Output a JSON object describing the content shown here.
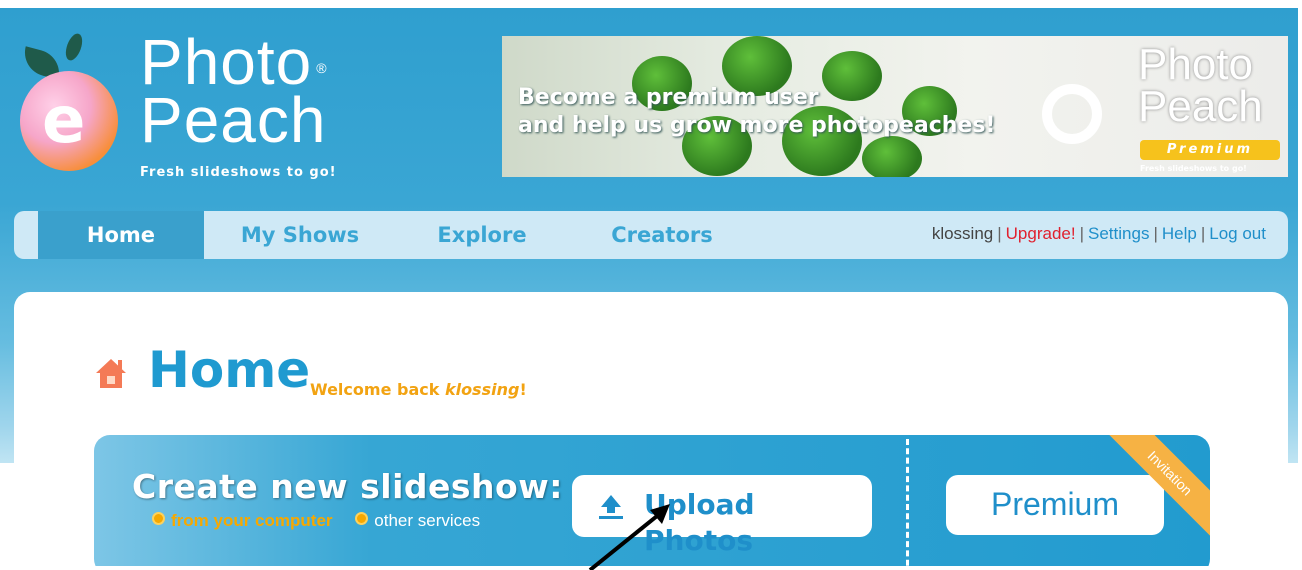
{
  "brand": {
    "name_line1": "Photo",
    "name_line2": "Peach",
    "registered": "®",
    "tagline": "Fresh slideshows to go!"
  },
  "banner": {
    "line1": "Become a premium user",
    "line2": "and help us grow more photopeaches!",
    "logo_line1": "Photo",
    "logo_line2": "Peach",
    "premium_label": "Premium",
    "logo_tagline": "Fresh slideshows to go!"
  },
  "nav": {
    "tabs": [
      {
        "label": "Home",
        "active": true
      },
      {
        "label": "My Shows",
        "active": false
      },
      {
        "label": "Explore",
        "active": false
      },
      {
        "label": "Creators",
        "active": false
      }
    ],
    "user": "klossing",
    "upgrade": "Upgrade!",
    "settings": "Settings",
    "help": "Help",
    "logout": "Log out"
  },
  "page": {
    "title": "Home",
    "welcome_prefix": "Welcome back",
    "welcome_user": "klossing",
    "welcome_suffix": "!"
  },
  "create": {
    "heading": "Create new slideshow:",
    "source_computer": "from your computer",
    "source_other": "other services",
    "upload_label": "Upload Photos",
    "premium_label": "Premium",
    "ribbon": "Invitation"
  },
  "colors": {
    "brand_blue": "#1f9ad0",
    "accent_orange": "#f2a312",
    "upgrade_red": "#e0212f"
  }
}
